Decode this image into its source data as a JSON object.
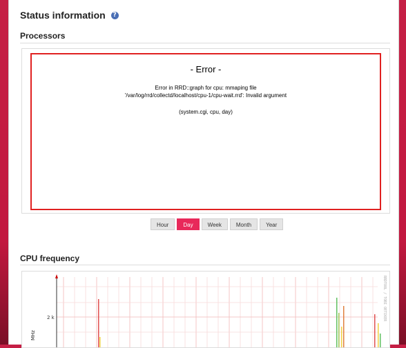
{
  "page": {
    "title": "Status information",
    "help_icon": "help-icon"
  },
  "processors": {
    "heading": "Processors",
    "error": {
      "title": "- Error -",
      "line1": "Error in RRD::graph for cpu: mmaping file",
      "line2": "'/var/log/rrd/collectd/localhost/cpu-1/cpu-wait.rrd': Invalid argument",
      "context": "(system.cgi, cpu, day)",
      "border_color": "#e02020"
    },
    "ranges": [
      "Hour",
      "Day",
      "Week",
      "Month",
      "Year"
    ],
    "active_range": "Day"
  },
  "cpu_frequency": {
    "heading": "CPU frequency",
    "y_tick": "2 k",
    "y_unit": "MHz",
    "watermark": "RRDTOOL / TOBI OETIKER"
  },
  "colors": {
    "accent": "#e8295a",
    "background": "#c51f45"
  }
}
